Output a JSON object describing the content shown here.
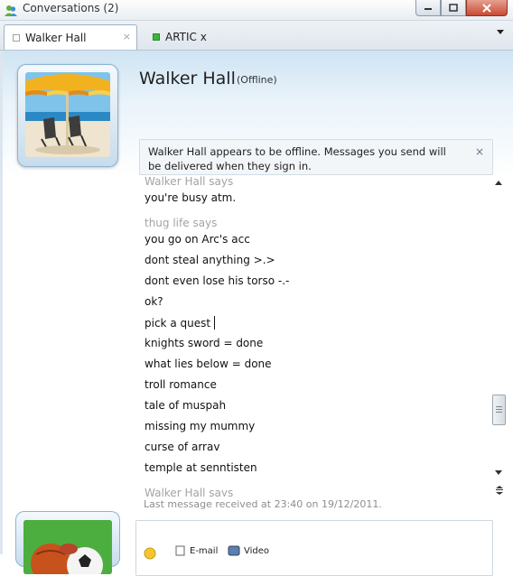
{
  "window": {
    "title": "Conversations (2)"
  },
  "tabs": [
    {
      "label": "Walker Hall",
      "status": "offline",
      "active": true,
      "close_glyph": "×"
    },
    {
      "label": "ARTIC x",
      "status": "online",
      "active": false
    }
  ],
  "contact": {
    "name": "Walker Hall",
    "status": "(Offline)"
  },
  "notice": {
    "text": "Walker Hall appears to be offline. Messages you send will be delivered when they sign in.",
    "close_glyph": "×"
  },
  "history": {
    "sender_walker_top": "Walker Hall says",
    "msg_busy": "you're busy atm.",
    "sender_thug": "thug life says",
    "messages": [
      "you go on Arc's acc",
      "dont steal anything >.>",
      "dont even lose his torso -.-",
      "ok?",
      "pick a quest",
      "knights sword = done",
      "what lies below = done",
      "troll romance",
      "tale of muspah",
      "missing my mummy",
      "curse of arrav",
      "temple at senntisten"
    ],
    "sender_walker_bottom": "Walker Hall says"
  },
  "status_line": "Last message received at 23:40 on 19/12/2011.",
  "toolbar": {
    "email_label": "E-mail",
    "video_label": "Video"
  },
  "colors": {
    "sender_gray": "#a3a3a3",
    "online_green": "#3bb53b",
    "header_blue": "#cfe4f3"
  }
}
